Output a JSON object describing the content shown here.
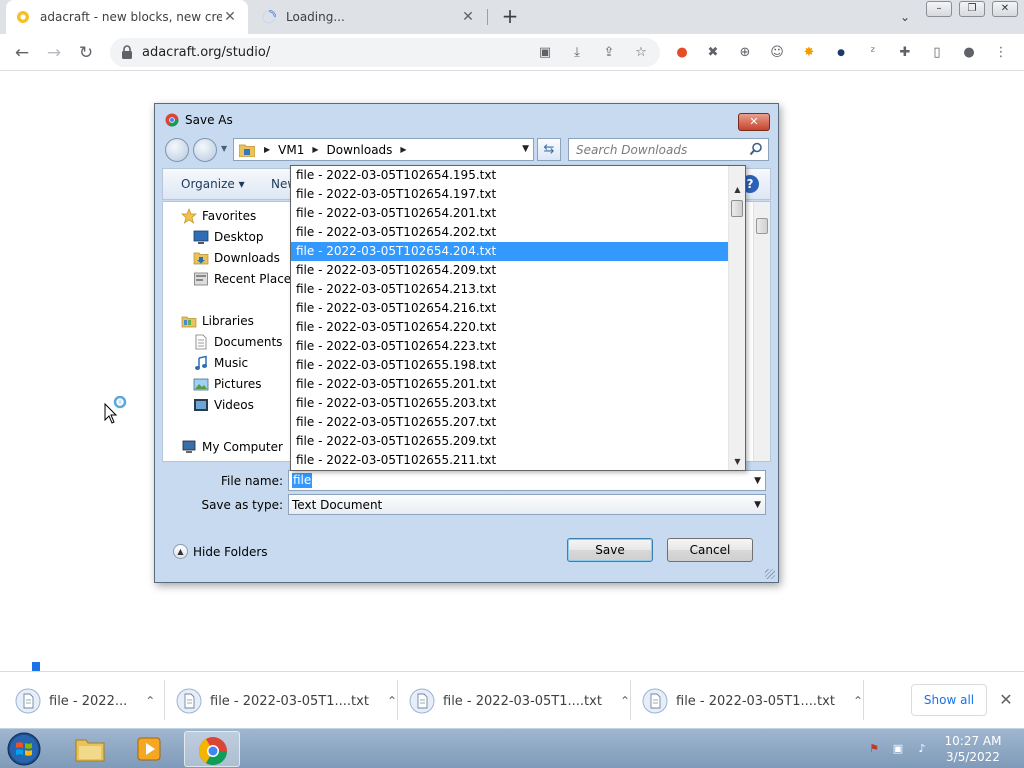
{
  "browser": {
    "tabs": [
      {
        "title": "adacraft - new blocks, new creati",
        "active": true
      },
      {
        "title": "Loading...",
        "active": false
      }
    ],
    "url": "adacraft.org/studio/"
  },
  "dialog": {
    "title": "Save As",
    "path": [
      "VM1",
      "Downloads"
    ],
    "search_placeholder": "Search Downloads",
    "toolbar": {
      "organize": "Organize",
      "new_folder": "New"
    },
    "nav": [
      {
        "label": "Favorites",
        "icon": "star-icon"
      },
      {
        "label": "Desktop",
        "icon": "desktop-icon"
      },
      {
        "label": "Downloads",
        "icon": "downloads-folder-icon"
      },
      {
        "label": "Recent Places",
        "icon": "recent-places-icon"
      },
      {
        "label": "Libraries",
        "icon": "libraries-icon"
      },
      {
        "label": "Documents",
        "icon": "documents-icon"
      },
      {
        "label": "Music",
        "icon": "music-icon"
      },
      {
        "label": "Pictures",
        "icon": "pictures-icon"
      },
      {
        "label": "Videos",
        "icon": "videos-icon"
      },
      {
        "label": "My Computer",
        "icon": "computer-icon"
      }
    ],
    "file_name_label": "File name:",
    "file_name_value": "file",
    "save_type_label": "Save as type:",
    "save_type_value": "Text Document",
    "hide_folders": "Hide Folders",
    "save_label": "Save",
    "cancel_label": "Cancel"
  },
  "autocomplete": {
    "items": [
      "file - 2022-03-05T102654.195.txt",
      "file - 2022-03-05T102654.197.txt",
      "file - 2022-03-05T102654.201.txt",
      "file - 2022-03-05T102654.202.txt",
      "file - 2022-03-05T102654.204.txt",
      "file - 2022-03-05T102654.209.txt",
      "file - 2022-03-05T102654.213.txt",
      "file - 2022-03-05T102654.216.txt",
      "file - 2022-03-05T102654.220.txt",
      "file - 2022-03-05T102654.223.txt",
      "file - 2022-03-05T102655.198.txt",
      "file - 2022-03-05T102655.201.txt",
      "file - 2022-03-05T102655.203.txt",
      "file - 2022-03-05T102655.207.txt",
      "file - 2022-03-05T102655.209.txt",
      "file - 2022-03-05T102655.211.txt"
    ],
    "selected_item": "file - 2022-03-05T102654.204.txt"
  },
  "downloads": {
    "items": [
      "file - 2022...",
      "file - 2022-03-05T1....txt",
      "file - 2022-03-05T1....txt",
      "file - 2022-03-05T1....txt"
    ],
    "show_all": "Show all"
  },
  "taskbar": {
    "time": "10:27 AM",
    "date": "3/5/2022"
  }
}
